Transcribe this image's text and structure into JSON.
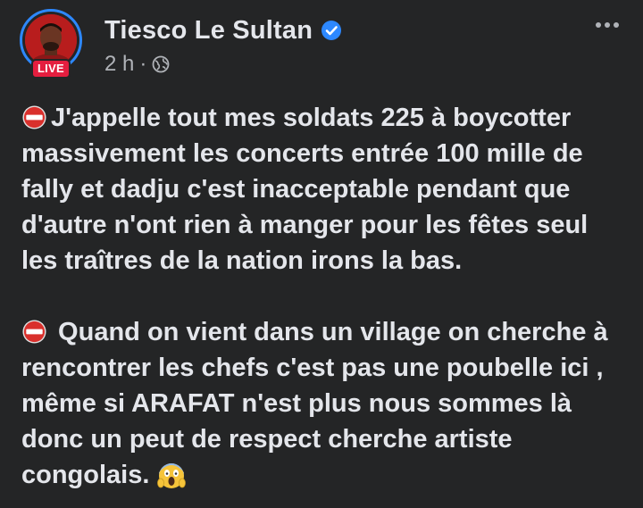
{
  "post": {
    "author_name": "Tiesco Le Sultan",
    "live_badge": "LIVE",
    "time": "2 h",
    "meta_separator": "·",
    "audience_icon": "globe-icon",
    "verified_icon": "verified-badge-icon",
    "more_icon": "more-options-icon",
    "paragraphs": [
      {
        "leading_icon": "no-entry-icon",
        "text": "J'appelle tout mes soldats 225 à boycotter massivement les concerts entrée 100 mille de fally et dadju c'est inacceptable pendant que d'autre n'ont rien à manger pour les fêtes seul les traîtres de la nation irons la bas."
      },
      {
        "leading_icon": "no-entry-icon",
        "text": " Quand on vient dans un village on cherche à rencontrer les chefs c'est pas une poubelle ici , même si ARAFAT n'est plus nous sommes là donc un peut de respect cherche artiste congolais.",
        "trailing_icon": "face-screaming-in-fear-icon"
      }
    ]
  },
  "colors": {
    "background": "#242526",
    "text_primary": "#e4e6eb",
    "text_secondary": "#b0b3b8",
    "accent_blue": "#2d88ff",
    "live_red": "#e41e3f"
  }
}
